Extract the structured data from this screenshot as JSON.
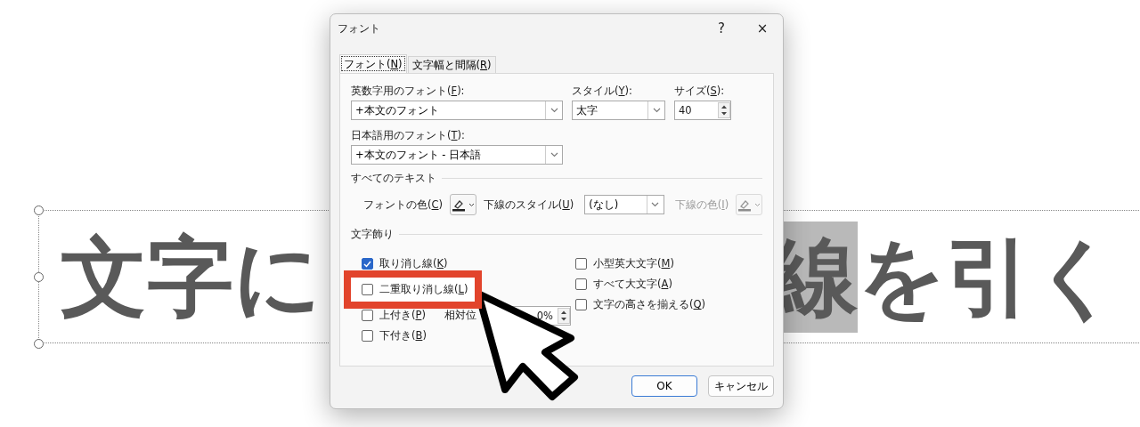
{
  "slide": {
    "text_left": "文字に",
    "text_selected": "線",
    "text_right": "を引く"
  },
  "dialog": {
    "title": "フォント",
    "help": "?",
    "close": "×",
    "tabs": [
      {
        "label": "フォント(N)",
        "selected": true
      },
      {
        "label": "文字幅と間隔(R)",
        "selected": false
      }
    ],
    "latin_font": {
      "label": "英数字用のフォント(F):",
      "value": "+本文のフォント"
    },
    "style": {
      "label": "スタイル(Y):",
      "value": "太字"
    },
    "size": {
      "label": "サイズ(S):",
      "value": "40"
    },
    "asian_font": {
      "label": "日本語用のフォント(T):",
      "value": "+本文のフォント - 日本語"
    },
    "all_text": {
      "heading": "すべてのテキスト",
      "font_color_label": "フォントの色(C)",
      "underline_style_label": "下線のスタイル(U)",
      "underline_style_value": "(なし)",
      "underline_color_label": "下線の色(I)",
      "underline_color_disabled": true
    },
    "effects": {
      "heading": "文字飾り",
      "offset_label": "相対位",
      "offset_value": "0%",
      "left": [
        {
          "label": "取り消し線(K)",
          "checked": true,
          "highlighted": false
        },
        {
          "label": "二重取り消し線(L)",
          "checked": false,
          "highlighted": true
        },
        {
          "label": "上付き(P)",
          "checked": false,
          "highlighted": false
        },
        {
          "label": "下付き(B)",
          "checked": false,
          "highlighted": false
        }
      ],
      "right": [
        {
          "label": "小型英大文字(M)",
          "checked": false
        },
        {
          "label": "すべて大文字(A)",
          "checked": false
        },
        {
          "label": "文字の高さを揃える(Q)",
          "checked": false
        }
      ]
    },
    "buttons": [
      {
        "label": "OK",
        "default": true
      },
      {
        "label": "キャンセル",
        "default": false
      }
    ]
  }
}
